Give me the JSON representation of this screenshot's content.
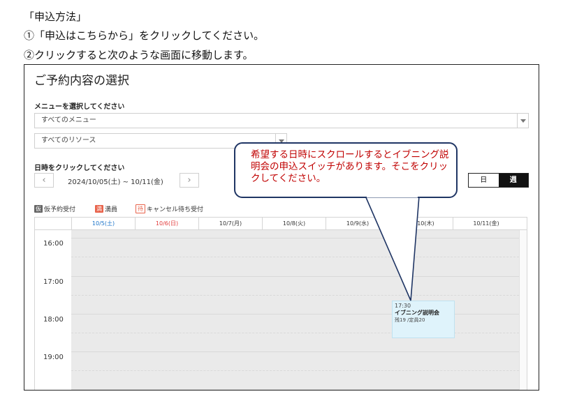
{
  "doc": {
    "line1": "「申込方法」",
    "line2": "①「申込はこちらから」をクリックしてください。",
    "line3": "②クリックすると次のような画面に移動します。"
  },
  "booking": {
    "title": "ご予約内容の選択",
    "menu_label": "メニューを選択してください",
    "menu_select": "すべてのメニュー",
    "resource_select": "すべてのリソース",
    "date_label": "日時をクリックしてください",
    "prev_icon": "‹",
    "next_icon": "›",
    "date_range": "2024/10/05(土) ~ 10/11(金)",
    "view_day": "日",
    "view_week": "週"
  },
  "legend": [
    {
      "badge": "仮",
      "text": "仮予約受付",
      "color": "#666666"
    },
    {
      "badge": "満",
      "text": "満員",
      "color": "#e8624a"
    },
    {
      "badge": "待",
      "text": "キャンセル待ち受付",
      "color": "#e8624a"
    }
  ],
  "calendar": {
    "days": [
      {
        "label": "10/5(土)",
        "color": "#1a73c9"
      },
      {
        "label": "10/6(日)",
        "color": "#e23b3b"
      },
      {
        "label": "10/7(月)",
        "color": "#333333"
      },
      {
        "label": "10/8(火)",
        "color": "#333333"
      },
      {
        "label": "10/9(水)",
        "color": "#333333"
      },
      {
        "label": "10/10(木)",
        "color": "#333333"
      },
      {
        "label": "10/11(金)",
        "color": "#333333"
      }
    ],
    "times": [
      "16:00",
      "17:00",
      "18:00",
      "19:00"
    ],
    "event": {
      "time": "17:30",
      "name": "イブニング説明会",
      "seats": "残19 /定員20"
    }
  },
  "callout": {
    "text": "希望する日時にスクロールするとイブニング説明会の申込スイッチがあります。そこをクリックしてください。",
    "border_color": "#1f3564",
    "text_color": "#c00000"
  }
}
